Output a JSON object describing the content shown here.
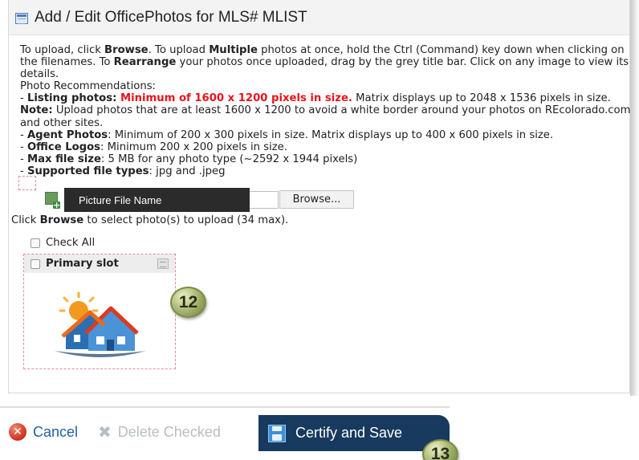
{
  "dialog": {
    "title": "Add / Edit OfficePhotos for MLS# MLIST"
  },
  "instructions": {
    "l1_a": "To upload, click ",
    "l1_b": "Browse",
    "l1_c": ". To upload ",
    "l1_d": "Multiple",
    "l1_e": " photos at once, hold the Ctrl (Command) key down when clicking on the filenames. To ",
    "l1_f": "Rearrange",
    "l1_g": " your photos once uploaded, drag by the grey title bar. Click on any image to view its details.",
    "rec_header": "Photo Recommendations:",
    "listing_dash": "- ",
    "listing_label": "Listing photos:",
    "listing_red": " Minimum of 1600 x 1200 pixels in size.",
    "listing_rest": " Matrix displays up to 2048 x 1536 pixels in size. ",
    "note_label": "Note:",
    "note_text": " Upload photos that are at least 1600 x 1200 to avoid a white border around your photos on REcolorado.com and other sites.",
    "agent_dash": "- ",
    "agent_label": "Agent Photos",
    "agent_text": ": Minimum of 200 x 300 pixels in size. Matrix displays up to 400 x 600 pixels in size.",
    "office_dash": "- ",
    "office_label": "Office Logos",
    "office_text": ": Minimum 200 x 200 pixels in size.",
    "max_dash": "- ",
    "max_label": "Max file size",
    "max_text": ": 5 MB for any photo type (~2592 x 1944 pixels)",
    "types_dash": "- ",
    "types_label": "Supported file types",
    "types_text": ": jpg and .jpeg"
  },
  "upload": {
    "tooltip": "Picture File Name",
    "browse_label": "Browse...",
    "hint_a": "Click ",
    "hint_b": "Browse",
    "hint_c": " to select photo(s) to upload (34 max)."
  },
  "check_all_label": "Check All",
  "slot": {
    "label": "Primary slot"
  },
  "badges": {
    "b12": "12",
    "b13": "13"
  },
  "toolbar": {
    "cancel_label": "Cancel",
    "delete_label": "Delete Checked",
    "certify_label": "Certify and Save"
  },
  "icons": {
    "title": "list-window-icon",
    "add_photo": "add-photo-icon",
    "slot_menu": "slot-menu-icon",
    "cancel": "cancel-icon",
    "delete": "delete-x-icon",
    "save": "save-disk-icon"
  },
  "colors": {
    "warning_red": "#e8131b",
    "link_blue": "#1f5fa8",
    "certify_bg": "#173a5e"
  }
}
